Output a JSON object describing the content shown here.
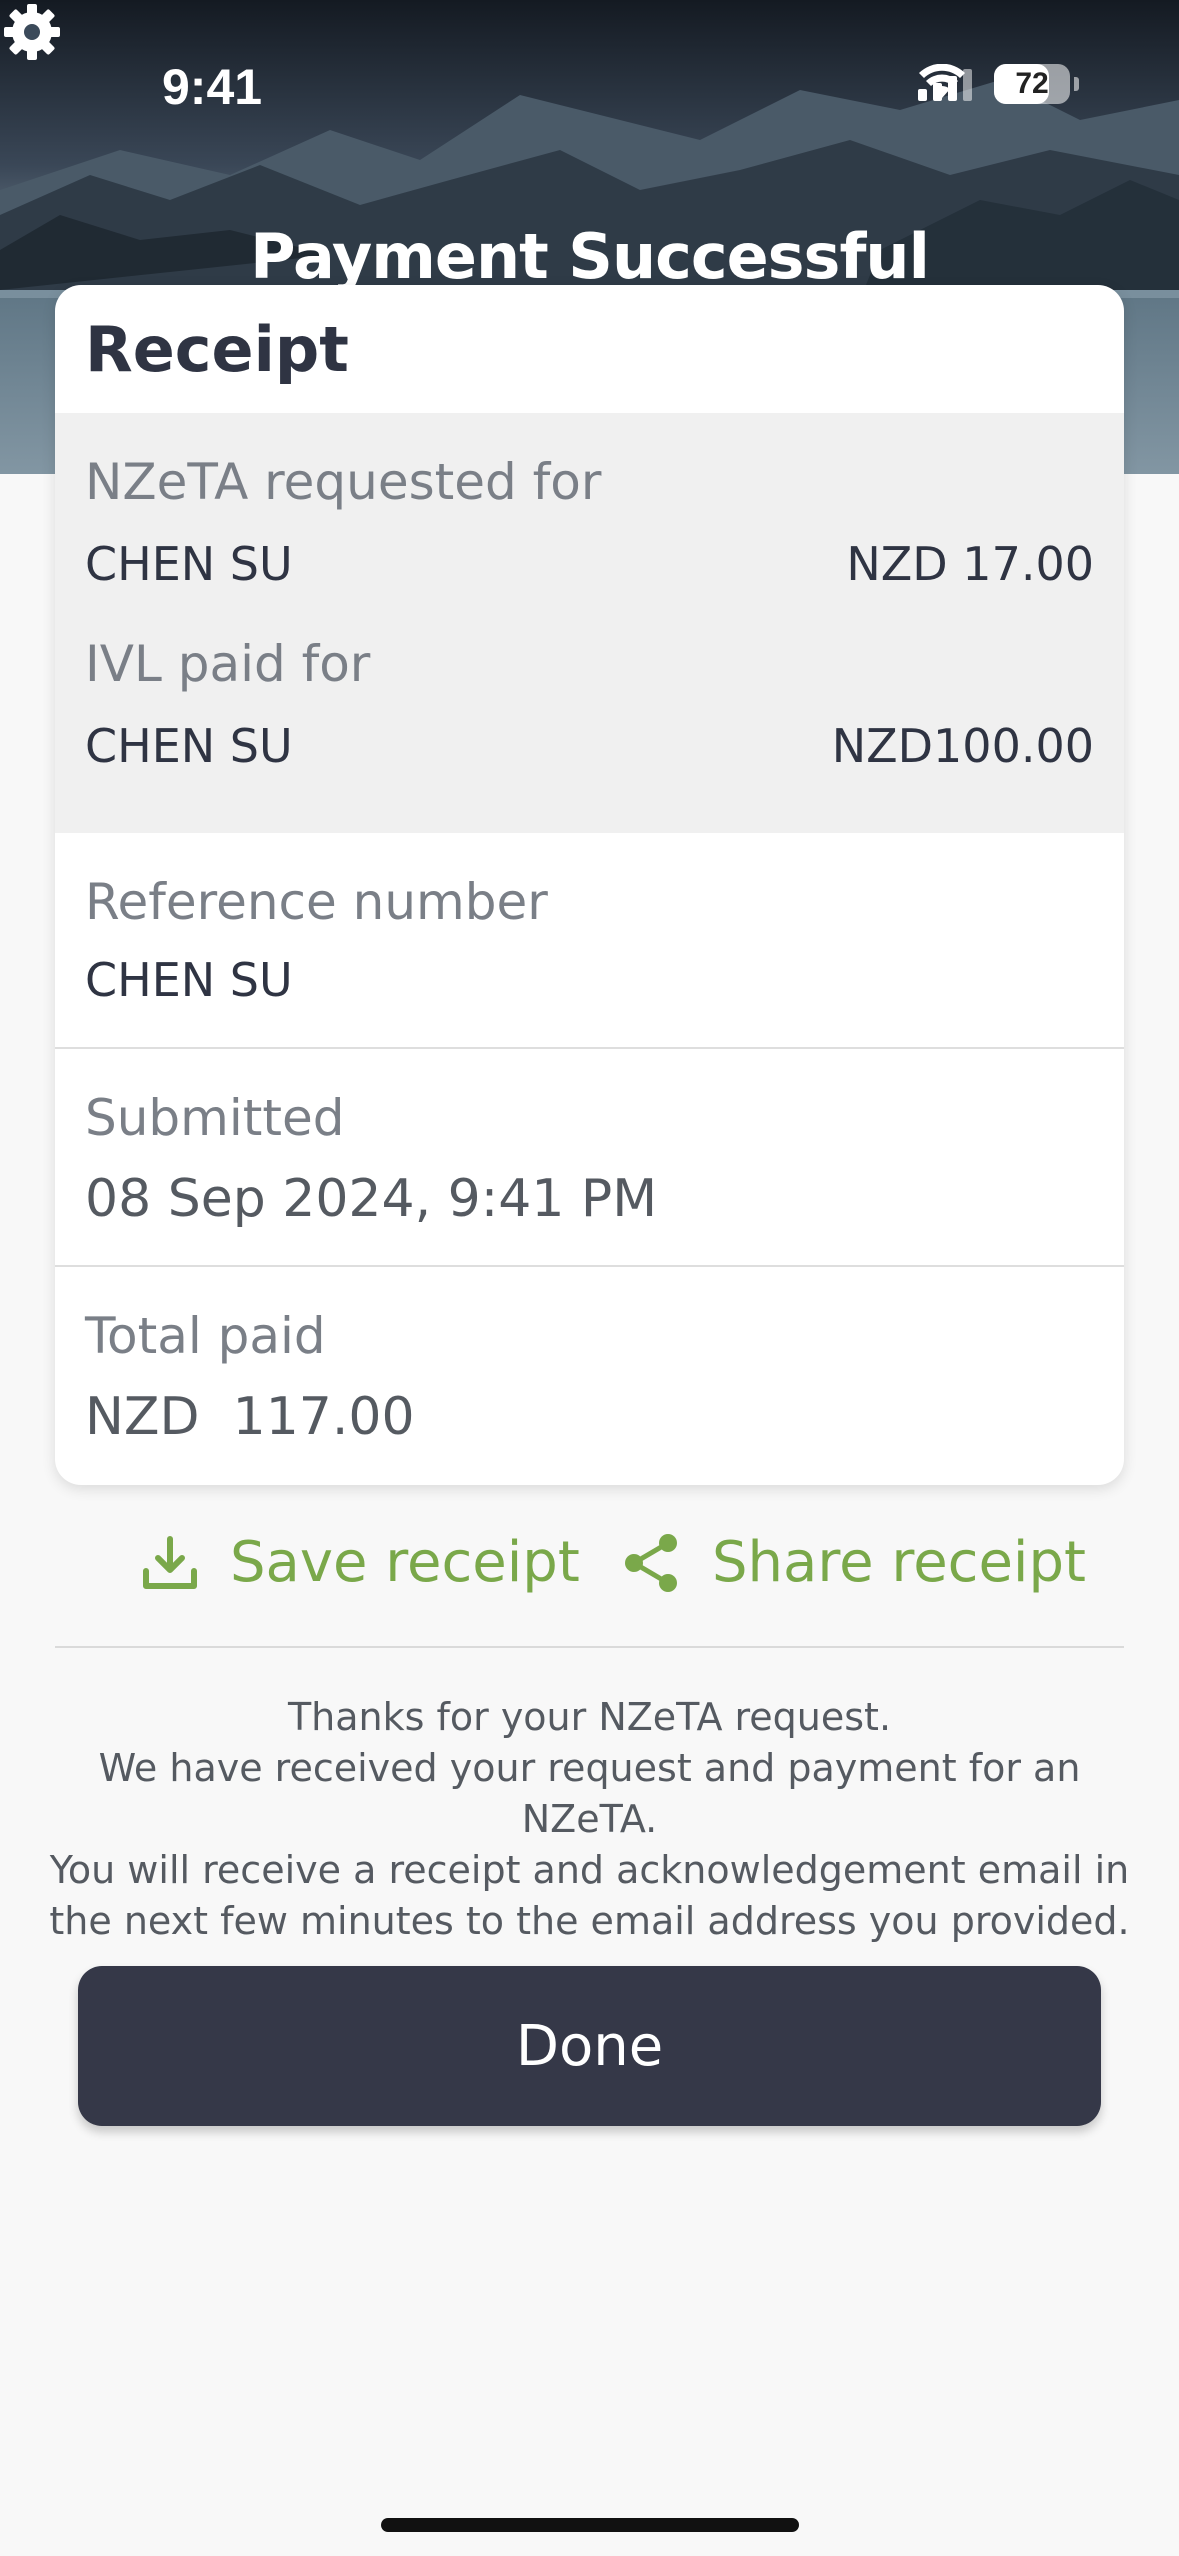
{
  "status_bar": {
    "time": "9:41",
    "battery_level": "72",
    "signal_icon": "cellular-signal-icon",
    "wifi_icon": "wifi-icon"
  },
  "header": {
    "title": "Payment Successful",
    "settings_icon": "gear-icon"
  },
  "receipt": {
    "title": "Receipt",
    "nzeta_label": "NZeTA requested for",
    "nzeta_name": "CHEN SU",
    "nzeta_amount": "NZD 17.00",
    "ivl_label": "IVL paid for",
    "ivl_name": "CHEN SU",
    "ivl_amount": "NZD100.00",
    "reference_label": "Reference number",
    "reference_value": "CHEN SU",
    "submitted_label": "Submitted",
    "submitted_value": "08 Sep 2024, 9:41 PM",
    "total_label": "Total paid",
    "total_value": "NZD  117.00"
  },
  "actions": {
    "save_label": "Save receipt",
    "save_icon": "download-icon",
    "share_label": "Share receipt",
    "share_icon": "share-icon",
    "accent_color": "#7aa84a"
  },
  "message": {
    "line1": "Thanks for your NZeTA request.",
    "line2": "We have received your request and payment for an NZeTA.",
    "line3": "You will receive a receipt and acknowledgement email in",
    "line4": "the next few minutes to the email address you provided."
  },
  "done_button": {
    "label": "Done",
    "color": "#353848"
  }
}
